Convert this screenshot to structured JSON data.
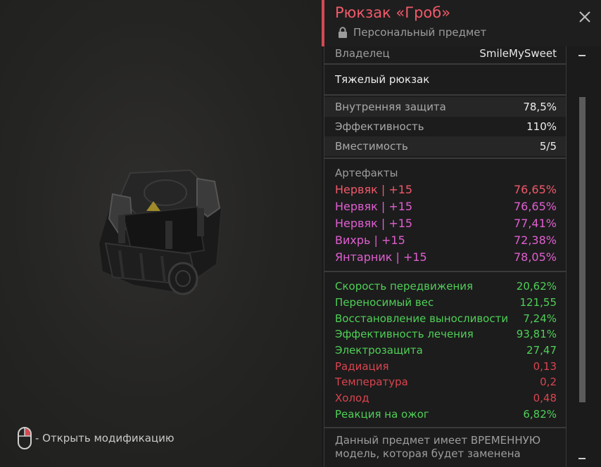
{
  "hint": {
    "text": "- Открыть модификацию",
    "icon": "mouse-right-click-icon"
  },
  "item": {
    "title": "Рюкзак «Гроб»",
    "subtitle": "Персональный предмет",
    "owner_label": "Владелец",
    "owner_value": "SmileMySweet",
    "category": "Тяжелый рюкзак"
  },
  "stats": [
    {
      "label": "Внутренняя защита",
      "value": "78,5%"
    },
    {
      "label": "Эффективность",
      "value": "110%"
    },
    {
      "label": "Вместимость",
      "value": "5/5"
    }
  ],
  "artifacts": {
    "heading": "Артефакты",
    "items": [
      {
        "label": "Нервяк | +15",
        "value": "76,65%",
        "color": "#f0596a"
      },
      {
        "label": "Нервяк | +15",
        "value": "76,65%",
        "color": "#e05fd0"
      },
      {
        "label": "Нервяк | +15",
        "value": "77,41%",
        "color": "#e05fd0"
      },
      {
        "label": "Вихрь | +15",
        "value": "72,38%",
        "color": "#e05fd0"
      },
      {
        "label": "Янтарник | +15",
        "value": "78,05%",
        "color": "#e05fd0"
      }
    ]
  },
  "bonuses": [
    {
      "label": "Скорость передвижения",
      "value": "20,62%",
      "color": "#4fcf57"
    },
    {
      "label": "Переносимый вес",
      "value": "121,55",
      "color": "#4fcf57"
    },
    {
      "label": "Восстановление выносливости",
      "value": "7,24%",
      "color": "#4fcf57"
    },
    {
      "label": "Эффективность лечения",
      "value": "93,81%",
      "color": "#4fcf57"
    },
    {
      "label": "Электрозащита",
      "value": "27,47",
      "color": "#4fcf57"
    },
    {
      "label": "Радиация",
      "value": "0,13",
      "color": "#d8454f"
    },
    {
      "label": "Температура",
      "value": "0,2",
      "color": "#d8454f"
    },
    {
      "label": "Холод",
      "value": "0,48",
      "color": "#d8454f"
    },
    {
      "label": "Реакция на ожог",
      "value": "6,82%",
      "color": "#4fcf57"
    }
  ],
  "note": "Данный предмет имеет ВРЕМЕННУЮ модель, которая будет заменена",
  "colors": {
    "accent": "#d44a52",
    "title": "#f0596a",
    "positive": "#4fcf57",
    "negative": "#d8454f",
    "artifact": "#e05fd0"
  },
  "icons": {
    "lock": "lock-icon",
    "close": "close-icon",
    "model": "backpack-model"
  }
}
